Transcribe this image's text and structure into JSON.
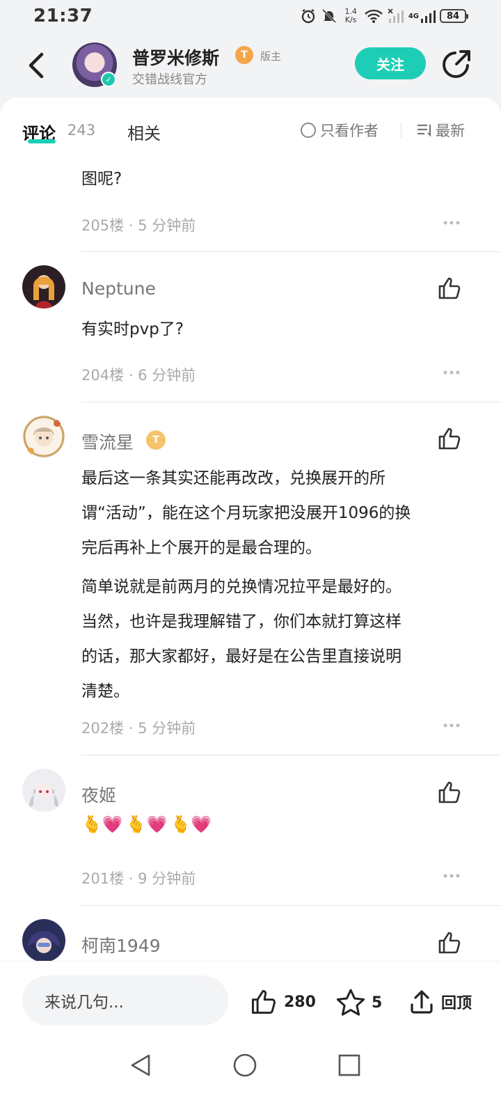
{
  "status_bar": {
    "time": "21:37",
    "net_speed_value": "1.4",
    "net_speed_unit": "K/s",
    "network": "4G",
    "battery": "84"
  },
  "header": {
    "author_name": "普罗米修斯",
    "rank_badge": "T",
    "role_tag": "版主",
    "author_sub": "交错战线官方",
    "follow_label": "关注"
  },
  "tabs": {
    "comments_label": "评论",
    "comments_count": "243",
    "related_label": "相关",
    "only_author_label": "只看作者",
    "sort_label": "最新"
  },
  "comments": [
    {
      "text": "图呢?",
      "floor": "205楼",
      "time": "5 分钟前"
    },
    {
      "name": "Neptune",
      "text": "有实时pvp了?",
      "floor": "204楼",
      "time": "6 分钟前"
    },
    {
      "name": "雪流星",
      "badge": "T",
      "text_lines": [
        "最后这一条其实还能再改改，兑换展开的所",
        "谓“活动”，能在这个月玩家把没展开1096的换",
        "完后再补上个展开的是最合理的。"
      ],
      "text2_lines": [
        "简单说就是前两月的兑换情况拉平是最好的。",
        "当然，也许是我理解错了，你们本就打算这样",
        "的话，那大家都好，最好是在公告里直接说明",
        "清楚。"
      ],
      "floor": "202楼",
      "time": "5 分钟前"
    },
    {
      "name": "夜姬",
      "emoji": [
        "🫰💗",
        "🫰💗",
        "🫰💗"
      ],
      "floor": "201楼",
      "time": "9 分钟前"
    },
    {
      "name": "柯南1949"
    }
  ],
  "meta_separator": "·",
  "bottom_bar": {
    "input_placeholder": "来说几句...",
    "like_count": "280",
    "fav_count": "5",
    "back_top_label": "回顶"
  },
  "colors": {
    "accent": "#1ecdb6",
    "badge_orange": "#f5a54a",
    "badge_gold": "#f5c46a"
  }
}
